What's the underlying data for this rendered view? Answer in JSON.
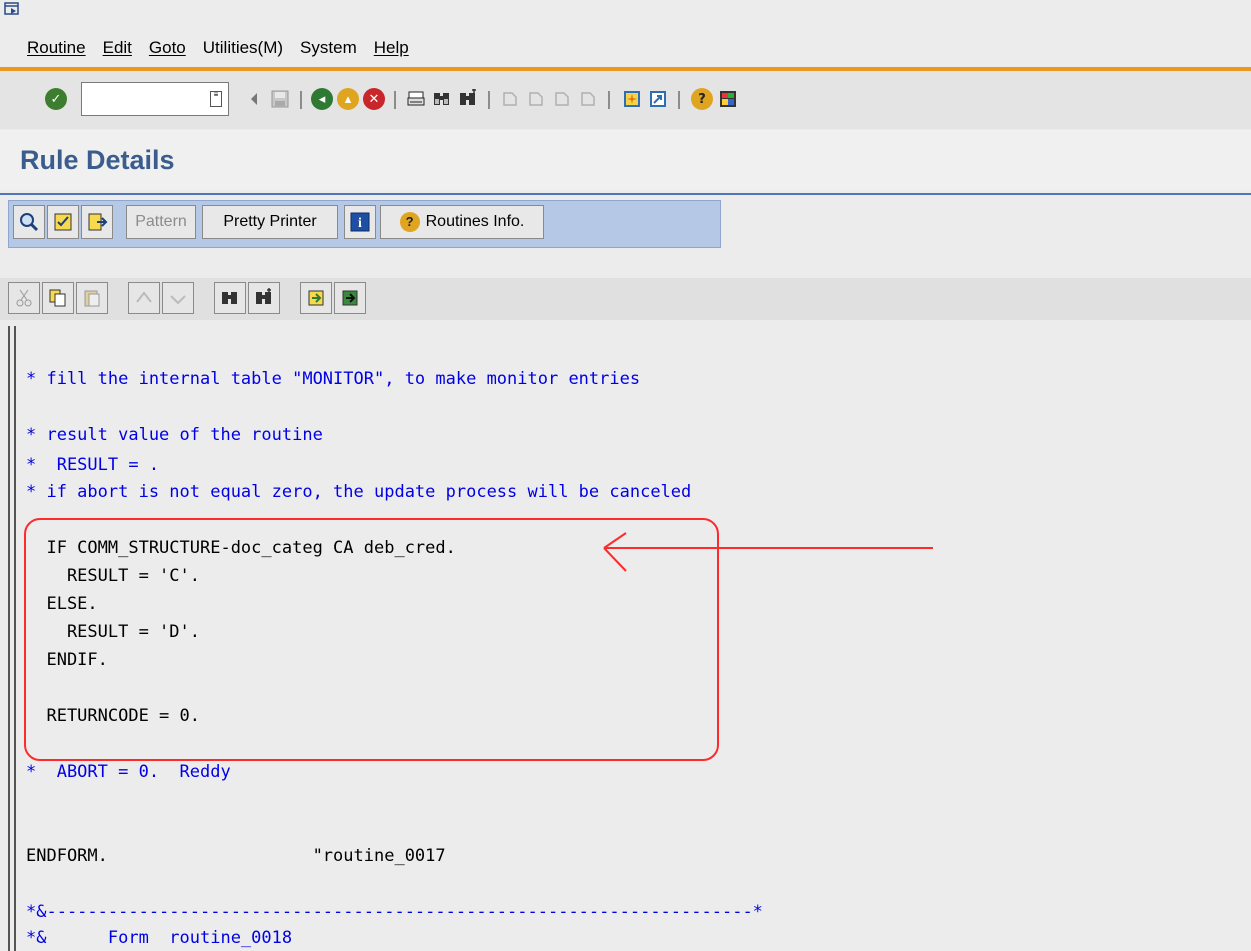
{
  "menu": [
    "Routine",
    "Edit",
    "Goto",
    "Utilities(M)",
    "System",
    "Help"
  ],
  "command_field": {
    "value": ""
  },
  "page_title": "Rule Details",
  "app_toolbar": {
    "pattern_label": "Pattern",
    "pretty_printer_label": "Pretty Printer",
    "routines_info_label": "Routines Info."
  },
  "code_lines": [
    "* fill the internal table \"MONITOR\", to make monitor entries",
    "* result value of the routine",
    "*  RESULT = .",
    "* if abort is not equal zero, the update process will be canceled",
    "  IF COMM_STRUCTURE-doc_categ CA deb_cred.",
    "    RESULT = 'C'.",
    "  ELSE.",
    "    RESULT = 'D'.",
    "  ENDIF.",
    "  RETURNCODE = 0.",
    "*  ABORT = 0.  Reddy",
    "ENDFORM.                    \"routine_0017",
    "*&---------------------------------------------------------------------*",
    "*&      Form  routine_0018"
  ],
  "colors": {
    "comment": "#0000e6",
    "annotation": "#ff2a2a",
    "title": "#3b5d8e",
    "accent_line": "#e99a1e"
  }
}
